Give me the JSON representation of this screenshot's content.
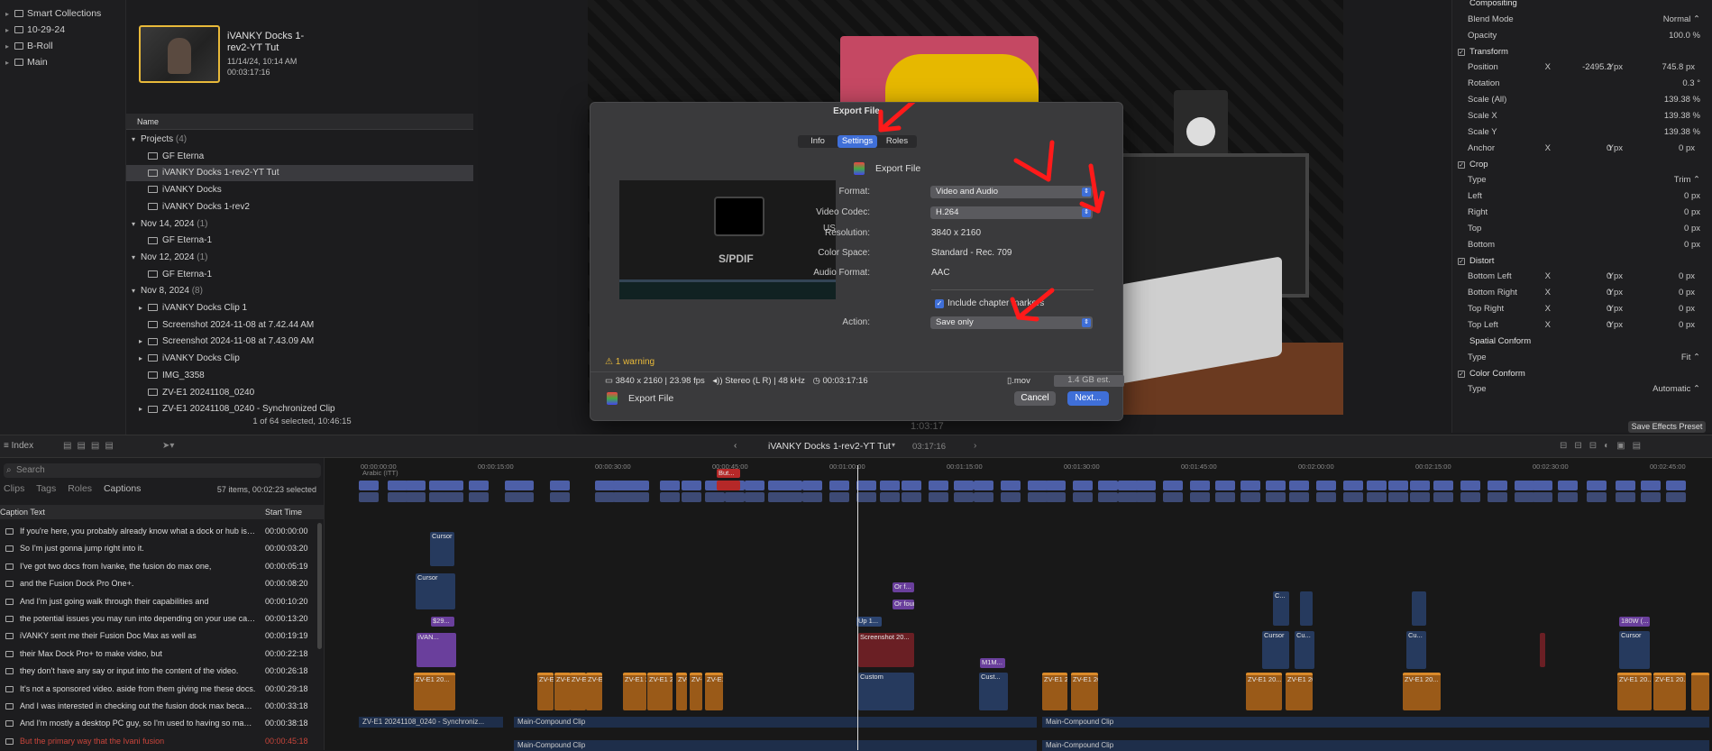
{
  "library": {
    "items": [
      {
        "label": "Smart Collections",
        "arrow": "▸"
      },
      {
        "label": "10-29-24",
        "arrow": "▸"
      },
      {
        "label": "B-Roll",
        "arrow": "▸"
      },
      {
        "label": "Main",
        "arrow": "▸"
      }
    ]
  },
  "browser": {
    "clip_title": "iVANKY Docks 1-rev2-YT Tut",
    "clip_date": "11/14/24, 10:14 AM",
    "clip_duration": "00:03:17:16",
    "column_name": "Name",
    "rows": [
      {
        "label": "Projects",
        "count": "(4)",
        "type": "group",
        "arrow": "▾"
      },
      {
        "label": "GF Eterna",
        "type": "item",
        "indent": 2
      },
      {
        "label": "iVANKY Docks 1-rev2-YT Tut",
        "type": "item",
        "indent": 2,
        "selected": true
      },
      {
        "label": "iVANKY Docks",
        "type": "item",
        "indent": 2
      },
      {
        "label": "iVANKY Docks 1-rev2",
        "type": "item",
        "indent": 2
      },
      {
        "label": "Nov 14, 2024",
        "count": "(1)",
        "type": "group",
        "arrow": "▾"
      },
      {
        "label": "GF Eterna-1",
        "type": "item",
        "indent": 2
      },
      {
        "label": "Nov 12, 2024",
        "count": "(1)",
        "type": "group",
        "arrow": "▾"
      },
      {
        "label": "GF Eterna-1",
        "type": "item",
        "indent": 2
      },
      {
        "label": "Nov 8, 2024",
        "count": "(8)",
        "type": "group",
        "arrow": "▾"
      },
      {
        "label": "iVANKY Docks Clip 1",
        "type": "item",
        "indent": 1,
        "arrow": "▸"
      },
      {
        "label": "Screenshot 2024-11-08 at 7.42.44 AM",
        "type": "item",
        "indent": 2
      },
      {
        "label": "Screenshot 2024-11-08 at 7.43.09 AM",
        "type": "item",
        "indent": 1,
        "arrow": "▸"
      },
      {
        "label": "iVANKY Docks Clip",
        "type": "item",
        "indent": 1,
        "arrow": "▸"
      },
      {
        "label": "IMG_3358",
        "type": "item",
        "indent": 2
      },
      {
        "label": "ZV-E1 20241108_0240",
        "type": "item",
        "indent": 2
      },
      {
        "label": "ZV-E1 20241108_0240 - Synchronized Clip",
        "type": "item",
        "indent": 1,
        "arrow": "▸"
      }
    ],
    "selection_status": "1 of 64 selected, 10:46:15"
  },
  "export_dialog": {
    "title": "Export File",
    "tabs": [
      "Info",
      "Settings",
      "Roles"
    ],
    "active_tab": "Settings",
    "header": "Export File",
    "format_label": "Format:",
    "format_value": "Video and Audio",
    "codec_label": "Video Codec:",
    "codec_value": "H.264",
    "resolution_label": "Resolution:",
    "resolution_value": "3840 x 2160",
    "colorspace_label": "Color Space:",
    "colorspace_value": "Standard - Rec. 709",
    "audio_label": "Audio Format:",
    "audio_value": "AAC",
    "chapter_label": "Include chapter markers",
    "action_label": "Action:",
    "action_value": "Save only",
    "warning": "1 warning",
    "summary_res": "3840 x 2160 | 23.98 fps",
    "summary_audio": "Stereo (L R) | 48 kHz",
    "summary_duration": "00:03:17:16",
    "file_ext": ".mov",
    "file_size": "1.4 GB est.",
    "footer_label": "Export File",
    "cancel": "Cancel",
    "next": "Next..."
  },
  "inspector": {
    "rows": [
      {
        "label": "Compositing",
        "kind": "sec"
      },
      {
        "label": "Blend Mode",
        "value": "Normal ⌃"
      },
      {
        "label": "Opacity",
        "value": "100.0 %"
      },
      {
        "label": "Transform",
        "kind": "chk"
      },
      {
        "label": "Position",
        "x": "-2495.2 px",
        "y": "745.8 px"
      },
      {
        "label": "Rotation",
        "value": "0.3 °"
      },
      {
        "label": "Scale (All)",
        "value": "139.38 %"
      },
      {
        "label": "Scale X",
        "value": "139.38 %"
      },
      {
        "label": "Scale Y",
        "value": "139.38 %"
      },
      {
        "label": "Anchor",
        "x": "0 px",
        "y": "0 px"
      },
      {
        "label": "Crop",
        "kind": "chk"
      },
      {
        "label": "Type",
        "value": "Trim ⌃"
      },
      {
        "label": "Left",
        "value": "0 px"
      },
      {
        "label": "Right",
        "value": "0 px"
      },
      {
        "label": "Top",
        "value": "0 px"
      },
      {
        "label": "Bottom",
        "value": "0 px"
      },
      {
        "label": "Distort",
        "kind": "chk"
      },
      {
        "label": "Bottom Left",
        "x": "0 px",
        "y": "0 px"
      },
      {
        "label": "Bottom Right",
        "x": "0 px",
        "y": "0 px"
      },
      {
        "label": "Top Right",
        "x": "0 px",
        "y": "0 px"
      },
      {
        "label": "Top Left",
        "x": "0 px",
        "y": "0 px"
      },
      {
        "label": "Spatial Conform",
        "kind": "sec"
      },
      {
        "label": "Type",
        "value": "Fit ⌃"
      },
      {
        "label": "Color Conform",
        "kind": "chk"
      },
      {
        "label": "Type",
        "value": "Automatic ⌃"
      }
    ],
    "save_preset": "Save Effects Preset",
    "x_label": "X",
    "y_label": "Y"
  },
  "toolbar": {
    "index_label": "Index",
    "project_title": "iVANKY Docks 1-rev2-YT Tut",
    "project_duration": "03:17:16",
    "viewer_timecode": "1:03:17"
  },
  "index": {
    "search_placeholder": "Search",
    "tabs": [
      "Clips",
      "Tags",
      "Roles",
      "Captions"
    ],
    "count": "57 items, 00:02:23 selected",
    "col_text": "Caption Text",
    "col_start": "Start Time",
    "rows": [
      {
        "text": "If you're here, you probably already know what a dock or hub is a...",
        "start": "00:00:00:00"
      },
      {
        "text": "So I'm just gonna jump right into it.",
        "start": "00:00:03:20"
      },
      {
        "text": "I've got two docs from Ivanke, the fusion do max one,",
        "start": "00:00:05:19"
      },
      {
        "text": "and the Fusion Dock Pro One+.",
        "start": "00:00:08:20"
      },
      {
        "text": "And I'm just going walk through their capabilities and",
        "start": "00:00:10:20"
      },
      {
        "text": "the potential issues you may run into depending on your use case...",
        "start": "00:00:13:20"
      },
      {
        "text": "iVANKY sent me their Fusion Doc Max as well as",
        "start": "00:00:19:19"
      },
      {
        "text": "their Max Dock Pro+ to make video, but",
        "start": "00:00:22:18"
      },
      {
        "text": "they don't have any say or input into the content of the video.",
        "start": "00:00:26:18"
      },
      {
        "text": "It's not a sponsored video. aside from them giving me these docs.",
        "start": "00:00:29:18"
      },
      {
        "text": "And I was interested in checking out the fusion dock max becaus...",
        "start": "00:00:33:18"
      },
      {
        "text": "And I'm mostly a desktop PC guy, so I'm used to having so many...",
        "start": "00:00:38:18"
      },
      {
        "text": "But the primary way that the Ivani fusion",
        "start": "00:00:45:18",
        "red": true
      }
    ]
  },
  "timeline": {
    "ruler": [
      "00:00:00:00",
      "00:00:15:00",
      "00:00:30:00",
      "00:00:45:00",
      "00:01:00:00",
      "00:01:15:00",
      "00:01:30:00",
      "00:01:45:00",
      "00:02:00:00",
      "00:02:15:00",
      "00:02:30:00",
      "00:02:45:00"
    ],
    "caption_lane": "Arabic (ITT)",
    "clip_labels": {
      "cursor": "Cursor",
      "or_f": "Or f...",
      "or_four": "Or four...",
      "s29": "$29...",
      "up1": "Up 1...",
      "ivan": "iVAN...",
      "screenshot": "Screenshot 20...",
      "m1m": "M1M...",
      "custom": "Custom",
      "cust": "Cust...",
      "zve1": "ZV-E1 20...",
      "c": "C...",
      "cu": "Cu...",
      "w180": "180W (...",
      "but": "But..."
    },
    "lane1": "ZV-E1 20241108_0240 - Synchroniz...",
    "lane2": "Main-Compound Clip",
    "lane3": "Main-Compound Clip"
  }
}
